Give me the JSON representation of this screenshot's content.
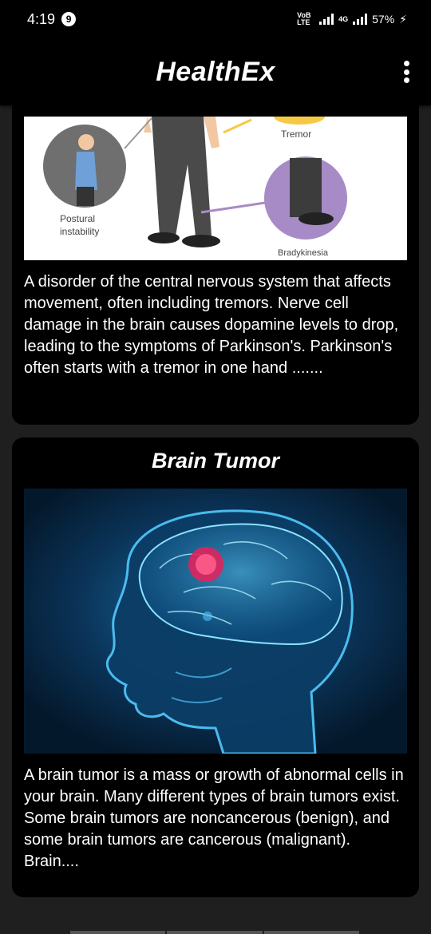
{
  "status_bar": {
    "time": "4:19",
    "notification_count": "9",
    "volte_label": "VoB LTE",
    "network_label": "4G",
    "battery": "57%"
  },
  "app_bar": {
    "title": "HealthEx",
    "menu_icon": "more-vert-icon"
  },
  "cards": [
    {
      "title": "",
      "image_labels": {
        "tremor": "Tremor",
        "postural": "Postural instability",
        "bradykinesia": "Bradykinesia"
      },
      "description": "A disorder of the central nervous system that affects movement, often including tremors. Nerve cell damage in the brain causes dopamine levels to drop, leading to the symptoms of Parkinson's. Parkinson's often starts with a tremor in one hand ......."
    },
    {
      "title": "Brain Tumor",
      "description": "A brain tumor is a mass or growth of abnormal cells in your brain. Many different types of brain tumors exist. Some brain tumors are noncancerous (benign), and some brain tumors are cancerous (malignant). Brain...."
    }
  ],
  "colors": {
    "background": "#1f1f1f",
    "card": "#000000",
    "tumor": "#e0245e",
    "scan_blue": "#1fa3e0"
  }
}
